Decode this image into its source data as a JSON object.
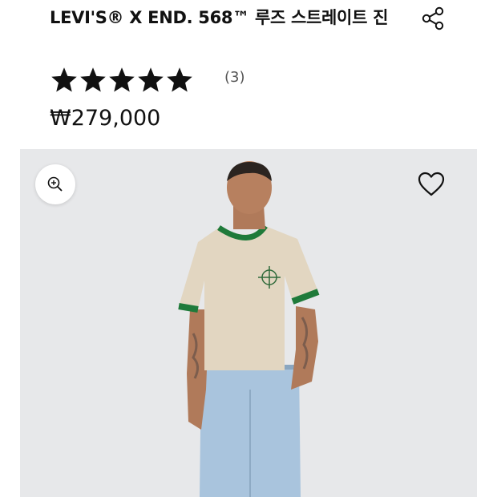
{
  "product": {
    "title": "LEVI'S® X END. 568™ 루즈 스트레이트 진",
    "rating": {
      "stars": 5,
      "review_count_label": "(3)"
    },
    "price": "₩279,000"
  },
  "icons": {
    "share": "share-icon",
    "zoom": "zoom-in-icon",
    "wishlist": "heart-icon",
    "star": "star-icon"
  },
  "colors": {
    "text": "#111111",
    "image_background": "#e7e8ea",
    "shirt": "#e2d6c1",
    "shirt_trim": "#1f7a3a",
    "denim": "#a9c4dd"
  }
}
